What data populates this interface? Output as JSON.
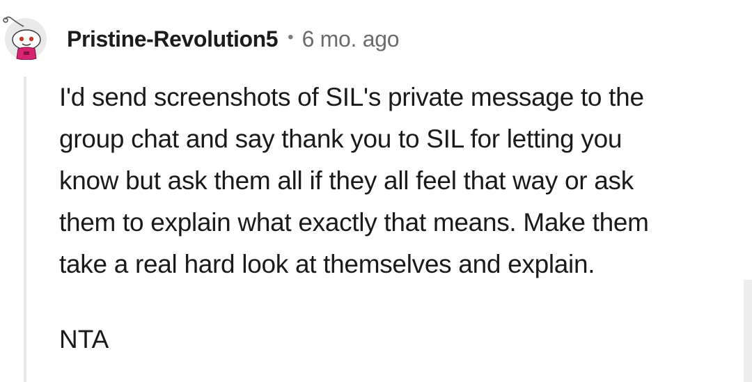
{
  "comment": {
    "author": "Pristine-Revolution5",
    "separator": "•",
    "timestamp": "6 mo. ago",
    "avatar_icon": "snoo-avatar-icon",
    "body_lines": [
      "I'd send screenshots of SIL's private message to the",
      "group chat and say thank you to SIL for letting you",
      "know but ask them all if they all feel that way or ask",
      "them to explain what exactly that means. Make them",
      "take a real hard look at themselves and explain."
    ],
    "verdict": "NTA"
  },
  "colors": {
    "avatar_bg": "#e9e9e9",
    "shirt": "#d6246e",
    "thread_line": "#e6e6e6",
    "timestamp": "#6b6b6b"
  }
}
